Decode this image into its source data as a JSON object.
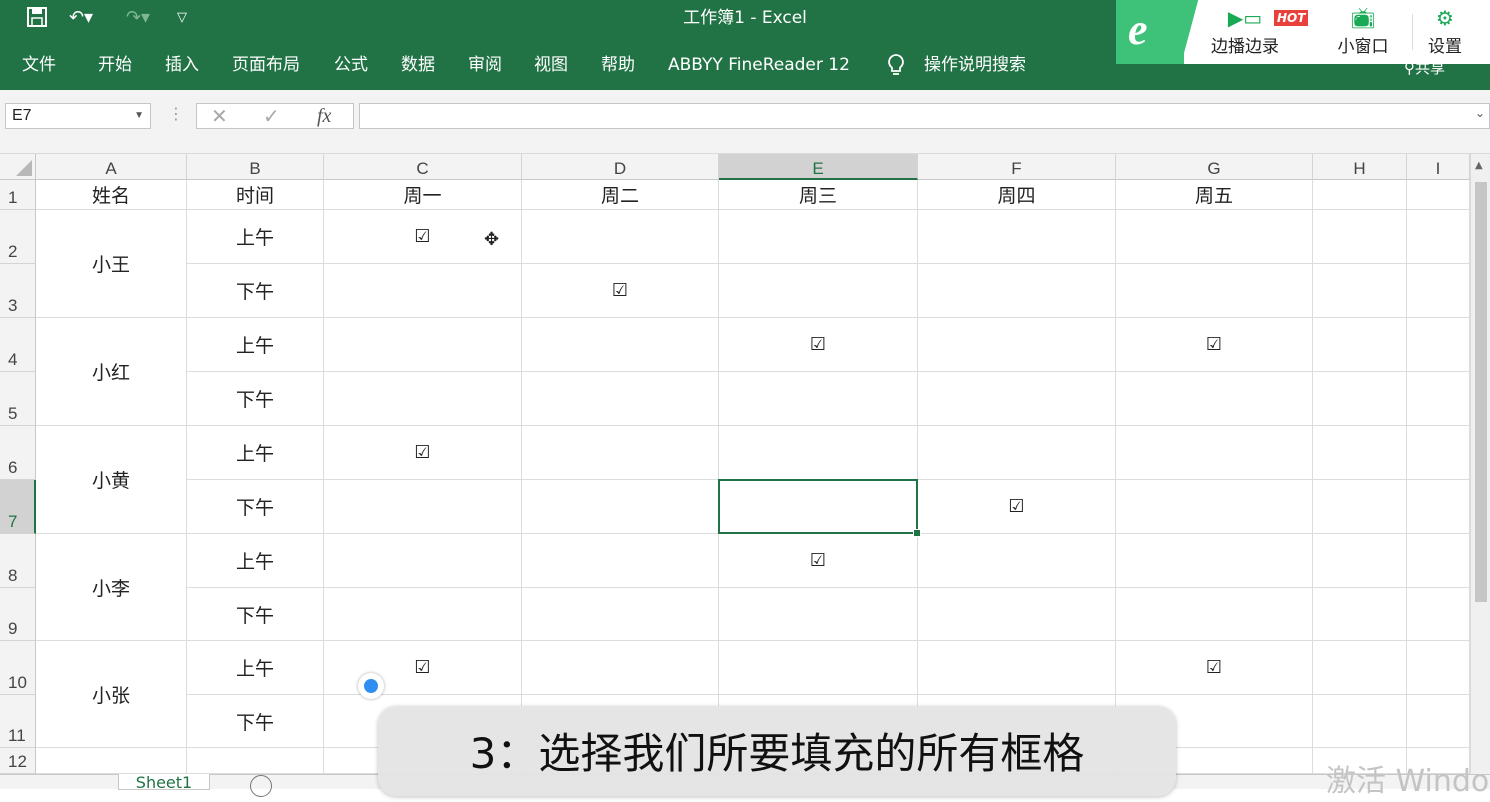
{
  "window": {
    "title": "工作簿1  -  Excel"
  },
  "qat": {
    "icons": [
      "save-icon",
      "undo-icon",
      "redo-icon",
      "customize-icon"
    ]
  },
  "ribbon": {
    "tabs": [
      "文件",
      "开始",
      "插入",
      "页面布局",
      "公式",
      "数据",
      "审阅",
      "视图",
      "帮助",
      "ABBYY FineReader 12"
    ],
    "search_label": "操作说明搜索",
    "share_label": "共享"
  },
  "overlay": {
    "items": [
      {
        "label": "边播边录",
        "icon": "video-record-icon"
      },
      {
        "label": "小窗口",
        "icon": "tv-icon"
      },
      {
        "label": "设置",
        "icon": "gear-icon"
      }
    ],
    "hot_badge": "HOT"
  },
  "formula_bar": {
    "name_box": "E7",
    "fx": "fx",
    "cancel": "✕",
    "enter": "✓",
    "value": ""
  },
  "sheet": {
    "columns": [
      "A",
      "B",
      "C",
      "D",
      "E",
      "F",
      "G",
      "H",
      "I"
    ],
    "selected_column": "E",
    "rows": [
      "1",
      "2",
      "3",
      "4",
      "5",
      "6",
      "7",
      "8",
      "9",
      "10",
      "11",
      "12"
    ],
    "selected_row": "7",
    "selected_cell": "E7",
    "header_row": [
      "姓名",
      "时间",
      "周一",
      "周二",
      "周三",
      "周四",
      "周五"
    ],
    "people": [
      {
        "name": "小王",
        "am": "上午",
        "pm": "下午",
        "am_checks": [
          "C"
        ],
        "pm_checks": [
          "D"
        ]
      },
      {
        "name": "小红",
        "am": "上午",
        "pm": "下午",
        "am_checks": [
          "E",
          "G"
        ],
        "pm_checks": []
      },
      {
        "name": "小黄",
        "am": "上午",
        "pm": "下午",
        "am_checks": [
          "C"
        ],
        "pm_checks": [
          "F"
        ]
      },
      {
        "name": "小李",
        "am": "上午",
        "pm": "下午",
        "am_checks": [
          "E"
        ],
        "pm_checks": []
      },
      {
        "name": "小张",
        "am": "上午",
        "pm": "下午",
        "am_checks": [
          "C",
          "G"
        ],
        "pm_checks": []
      }
    ],
    "check_symbol": "☑"
  },
  "sheet_tabs": {
    "active": "Sheet1"
  },
  "caption": "3：选择我们所要填充的所有框格",
  "watermark": "激活 Windo"
}
